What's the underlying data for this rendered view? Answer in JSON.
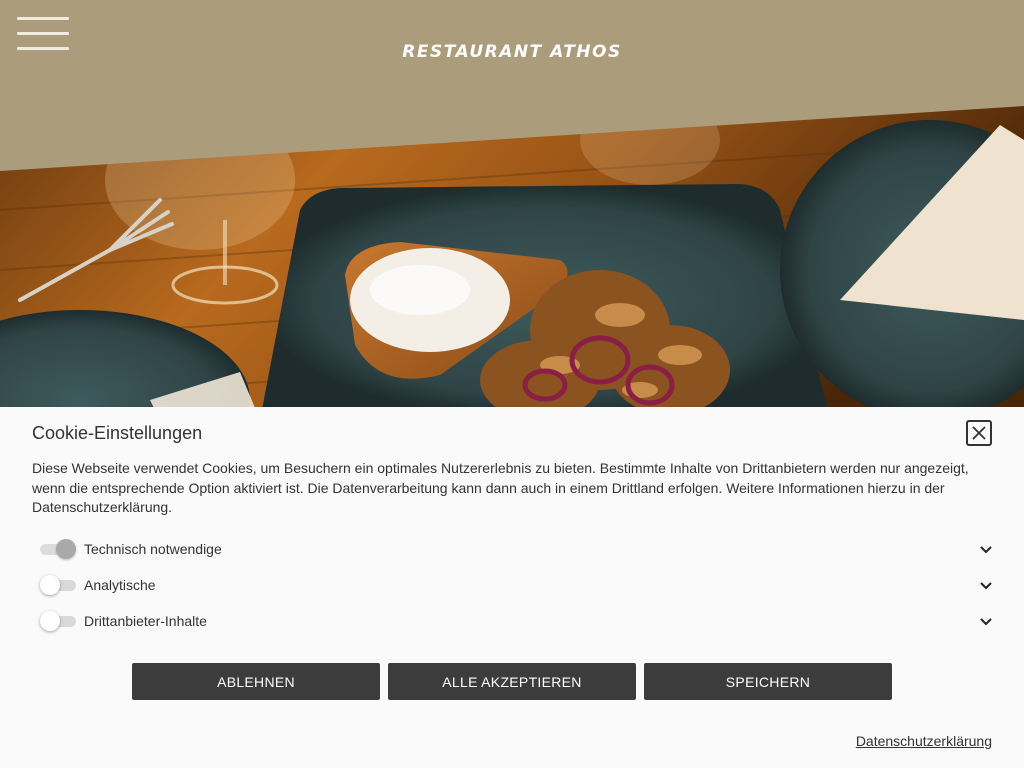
{
  "header": {
    "logo_text": "RESTAURANT ATHOS",
    "menu_icon": "hamburger-menu-icon",
    "background_color": "#ab9d7c"
  },
  "hero": {
    "image_subject": "hero-food-photo"
  },
  "cookie_banner": {
    "title": "Cookie-Einstellungen",
    "close_icon": "close-icon",
    "description": "Diese Webseite verwendet Cookies, um Besuchern ein optimales Nutzererlebnis zu bieten. Bestimmte Inhalte von Drittanbietern werden nur angezeigt, wenn die entsprechende Option aktiviert ist. Die Datenverarbeitung kann dann auch in einem Drittland erfolgen. Weitere Informationen hierzu in der Datenschutzerklärung.",
    "options": [
      {
        "label": "Technisch notwendige",
        "enabled": true,
        "locked": true,
        "icon": "chevron-down-icon"
      },
      {
        "label": "Analytische",
        "enabled": false,
        "locked": false,
        "icon": "chevron-down-icon"
      },
      {
        "label": "Drittanbieter-Inhalte",
        "enabled": false,
        "locked": false,
        "icon": "chevron-down-icon"
      }
    ],
    "buttons": {
      "reject": "ABLEHNEN",
      "accept_all": "ALLE AKZEPTIEREN",
      "save": "SPEICHERN"
    },
    "privacy_link": "Datenschutzerklärung",
    "button_color": "#3c3c3c",
    "background_color": "#fafafa"
  }
}
